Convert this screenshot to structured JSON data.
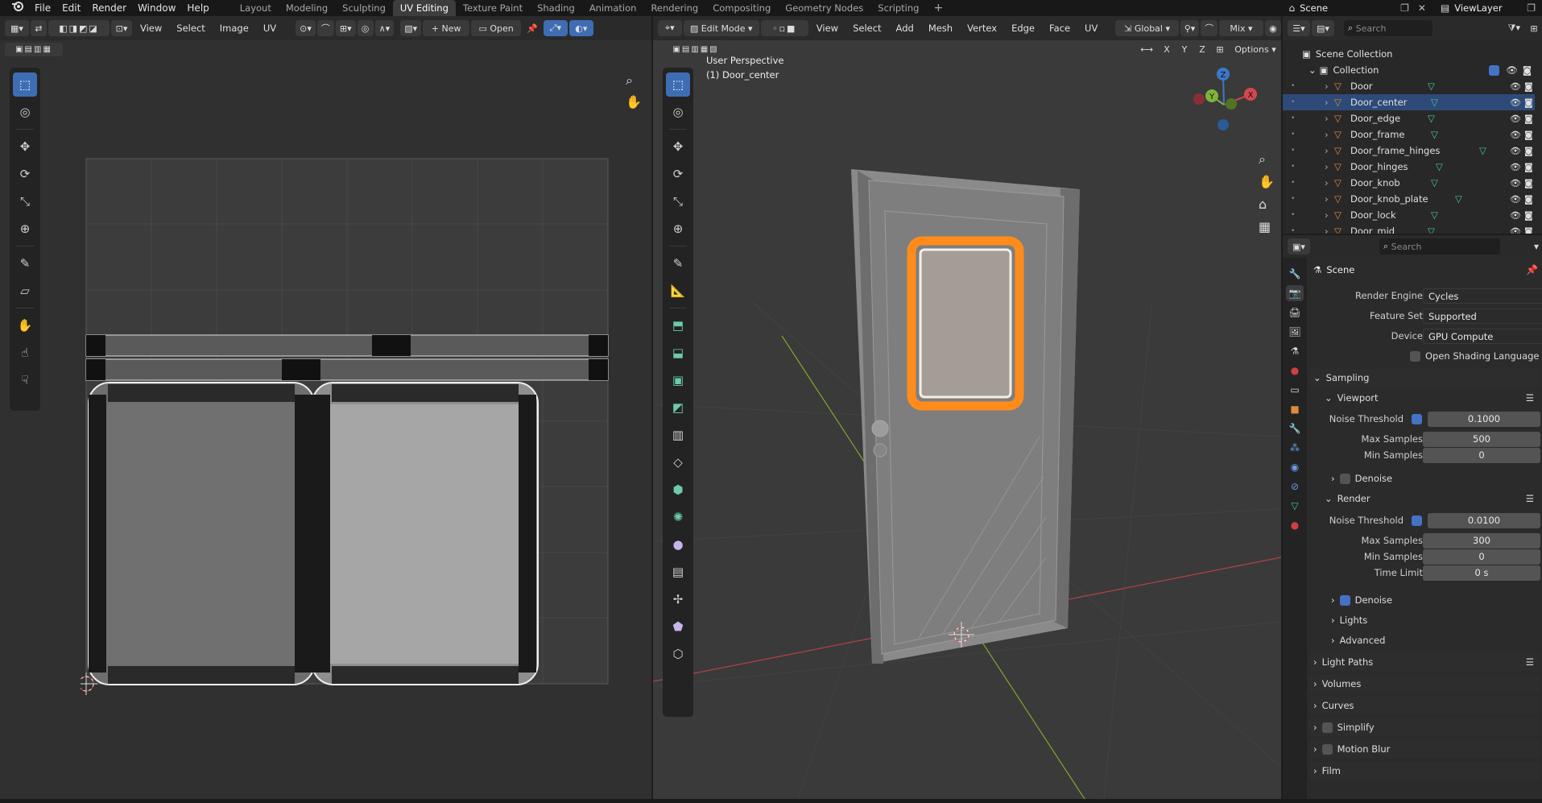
{
  "menus": [
    "File",
    "Edit",
    "Render",
    "Window",
    "Help"
  ],
  "workspaces": [
    "Layout",
    "Modeling",
    "Sculpting",
    "UV Editing",
    "Texture Paint",
    "Shading",
    "Animation",
    "Rendering",
    "Compositing",
    "Geometry Nodes",
    "Scripting"
  ],
  "active_workspace": "UV Editing",
  "scene_name": "Scene",
  "view_layer": "ViewLayer",
  "uv_editor": {
    "menus": [
      "View",
      "Select",
      "Image",
      "UV"
    ],
    "new_label": "New",
    "open_label": "Open"
  },
  "viewport": {
    "mode": "Edit Mode",
    "menus": [
      "View",
      "Select",
      "Add",
      "Mesh",
      "Vertex",
      "Edge",
      "Face",
      "UV"
    ],
    "transform_orientation": "Global",
    "shading_mix": "Mix",
    "overlay_title": "User Perspective",
    "overlay_object": "(1) Door_center",
    "axis_buttons": [
      "X",
      "Y",
      "Z"
    ],
    "options_label": "Options",
    "gizmo": {
      "x": "X",
      "y": "Y",
      "z": "Z"
    }
  },
  "outliner": {
    "search_placeholder": "Search",
    "root": "Scene Collection",
    "collection": "Collection",
    "items": [
      "Door",
      "Door_center",
      "Door_edge",
      "Door_frame",
      "Door_frame_hinges",
      "Door_hinges",
      "Door_knob",
      "Door_knob_plate",
      "Door_lock",
      "Door_mid"
    ],
    "selected": "Door_center"
  },
  "properties": {
    "search_placeholder": "Search",
    "context": "Scene",
    "render_engine_label": "Render Engine",
    "render_engine": "Cycles",
    "feature_set_label": "Feature Set",
    "feature_set": "Supported",
    "device_label": "Device",
    "device": "GPU Compute",
    "osl_label": "Open Shading Language",
    "sampling": "Sampling",
    "viewport": "Viewport",
    "render": "Render",
    "noise_threshold_label": "Noise Threshold",
    "max_samples_label": "Max Samples",
    "min_samples_label": "Min Samples",
    "time_limit_label": "Time Limit",
    "denoise_label": "Denoise",
    "vp_noise_threshold": "0.1000",
    "vp_max_samples": "500",
    "vp_min_samples": "0",
    "r_noise_threshold": "0.0100",
    "r_max_samples": "300",
    "r_min_samples": "0",
    "r_time_limit": "0 s",
    "lights": "Lights",
    "advanced": "Advanced",
    "light_paths": "Light Paths",
    "volumes": "Volumes",
    "curves": "Curves",
    "simplify": "Simplify",
    "motion_blur": "Motion Blur",
    "film": "Film"
  },
  "colors": {
    "accent": "#4772b3",
    "selection": "#ff8c1a",
    "outliner_selected": "#2e4a78",
    "mesh_icon": "#e08a3c",
    "data_icon": "#40c8a0"
  }
}
